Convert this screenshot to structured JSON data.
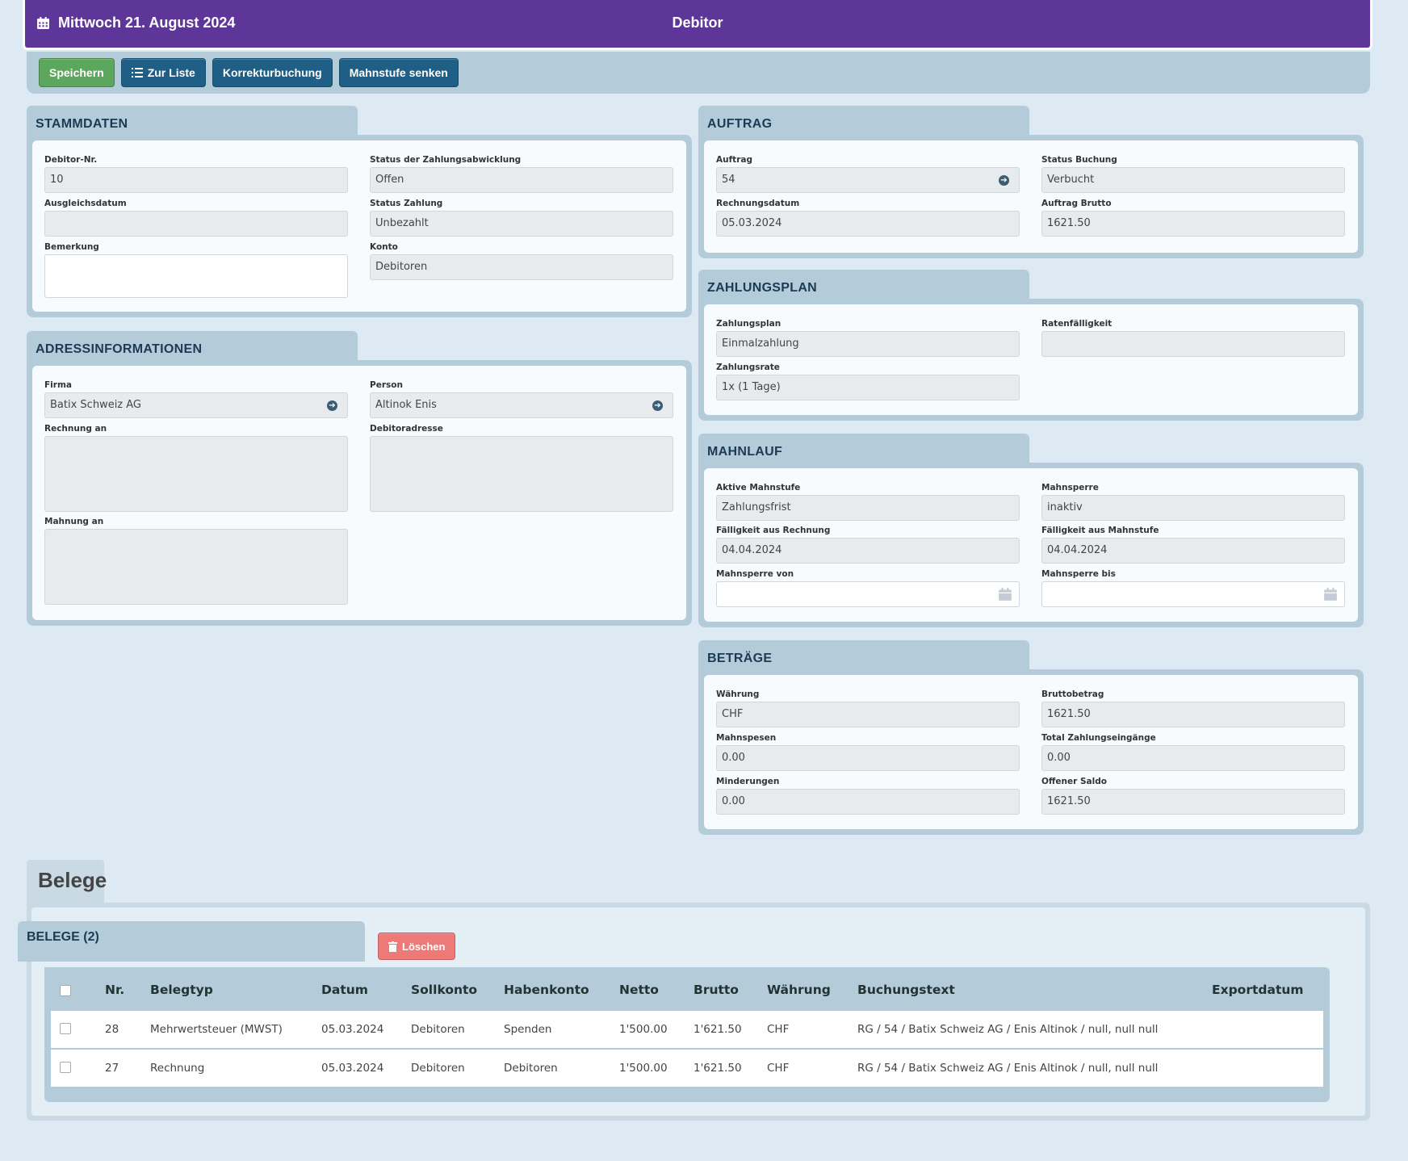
{
  "header": {
    "date": "Mittwoch 21. August 2024",
    "title": "Debitor"
  },
  "toolbar": {
    "save": "Speichern",
    "list": "Zur Liste",
    "correction": "Korrekturbuchung",
    "lower_level": "Mahnstufe senken"
  },
  "stammdaten": {
    "title": "STAMMDATEN",
    "debitor_nr_label": "Debitor-Nr.",
    "debitor_nr": "10",
    "status_abwicklung_label": "Status der Zahlungsabwicklung",
    "status_abwicklung": "Offen",
    "ausgleichsdatum_label": "Ausgleichsdatum",
    "ausgleichsdatum": "",
    "status_zahlung_label": "Status Zahlung",
    "status_zahlung": "Unbezahlt",
    "bemerkung_label": "Bemerkung",
    "bemerkung": "",
    "konto_label": "Konto",
    "konto": "Debitoren"
  },
  "adresse": {
    "title": "ADRESSINFORMATIONEN",
    "firma_label": "Firma",
    "firma": "Batix Schweiz AG",
    "person_label": "Person",
    "person": "Altinok Enis",
    "rechnung_an_label": "Rechnung an",
    "rechnung_an": "",
    "debitoradresse_label": "Debitoradresse",
    "debitoradresse": "",
    "mahnung_an_label": "Mahnung an",
    "mahnung_an": ""
  },
  "auftrag": {
    "title": "AUFTRAG",
    "auftrag_label": "Auftrag",
    "auftrag": "54",
    "status_buchung_label": "Status Buchung",
    "status_buchung": "Verbucht",
    "rechnungsdatum_label": "Rechnungsdatum",
    "rechnungsdatum": "05.03.2024",
    "auftrag_brutto_label": "Auftrag Brutto",
    "auftrag_brutto": "1621.50"
  },
  "zahlungsplan": {
    "title": "ZAHLUNGSPLAN",
    "plan_label": "Zahlungsplan",
    "plan": "Einmalzahlung",
    "raten_label": "Ratenfälligkeit",
    "raten": "",
    "rate_label": "Zahlungsrate",
    "rate": "1x (1 Tage)"
  },
  "mahnlauf": {
    "title": "MAHNLAUF",
    "aktive_label": "Aktive Mahnstufe",
    "aktive": "Zahlungsfrist",
    "sperre_label": "Mahnsperre",
    "sperre": "inaktiv",
    "faellig_rechnung_label": "Fälligkeit aus Rechnung",
    "faellig_rechnung": "04.04.2024",
    "faellig_mahnstufe_label": "Fälligkeit aus Mahnstufe",
    "faellig_mahnstufe": "04.04.2024",
    "sperre_von_label": "Mahnsperre von",
    "sperre_von": "",
    "sperre_bis_label": "Mahnsperre bis",
    "sperre_bis": ""
  },
  "betraege": {
    "title": "BETRÄGE",
    "waehrung_label": "Währung",
    "waehrung": "CHF",
    "brutto_label": "Bruttobetrag",
    "brutto": "1621.50",
    "mahnspesen_label": "Mahnspesen",
    "mahnspesen": "0.00",
    "total_label": "Total Zahlungseingänge",
    "total": "0.00",
    "minderungen_label": "Minderungen",
    "minderungen": "0.00",
    "saldo_label": "Offener Saldo",
    "saldo": "1621.50"
  },
  "belege": {
    "section_title": "Belege",
    "panel_title": "BELEGE (2)",
    "delete": "Löschen",
    "columns": [
      "Nr.",
      "Belegtyp",
      "Datum",
      "Sollkonto",
      "Habenkonto",
      "Netto",
      "Brutto",
      "Währung",
      "Buchungstext",
      "Exportdatum"
    ],
    "rows": [
      [
        "28",
        "Mehrwertsteuer (MWST)",
        "05.03.2024",
        "Debitoren",
        "Spenden",
        "1'500.00",
        "1'621.50",
        "CHF",
        "RG / 54 / Batix Schweiz AG / Enis Altinok / null, null null",
        ""
      ],
      [
        "27",
        "Rechnung",
        "05.03.2024",
        "Debitoren",
        "Debitoren",
        "1'500.00",
        "1'621.50",
        "CHF",
        "RG / 54 / Batix Schweiz AG / Enis Altinok / null, null null",
        ""
      ]
    ]
  },
  "icons": {
    "calendar": "calendar-icon",
    "list": "list-icon",
    "go": "arrow-circle-right-icon",
    "trash": "trash-icon"
  },
  "colors": {
    "topbar": "#5e3599",
    "save": "#5da65d",
    "primary": "#1f5f86",
    "danger": "#ee7a78",
    "panel": "#b4ccda"
  }
}
